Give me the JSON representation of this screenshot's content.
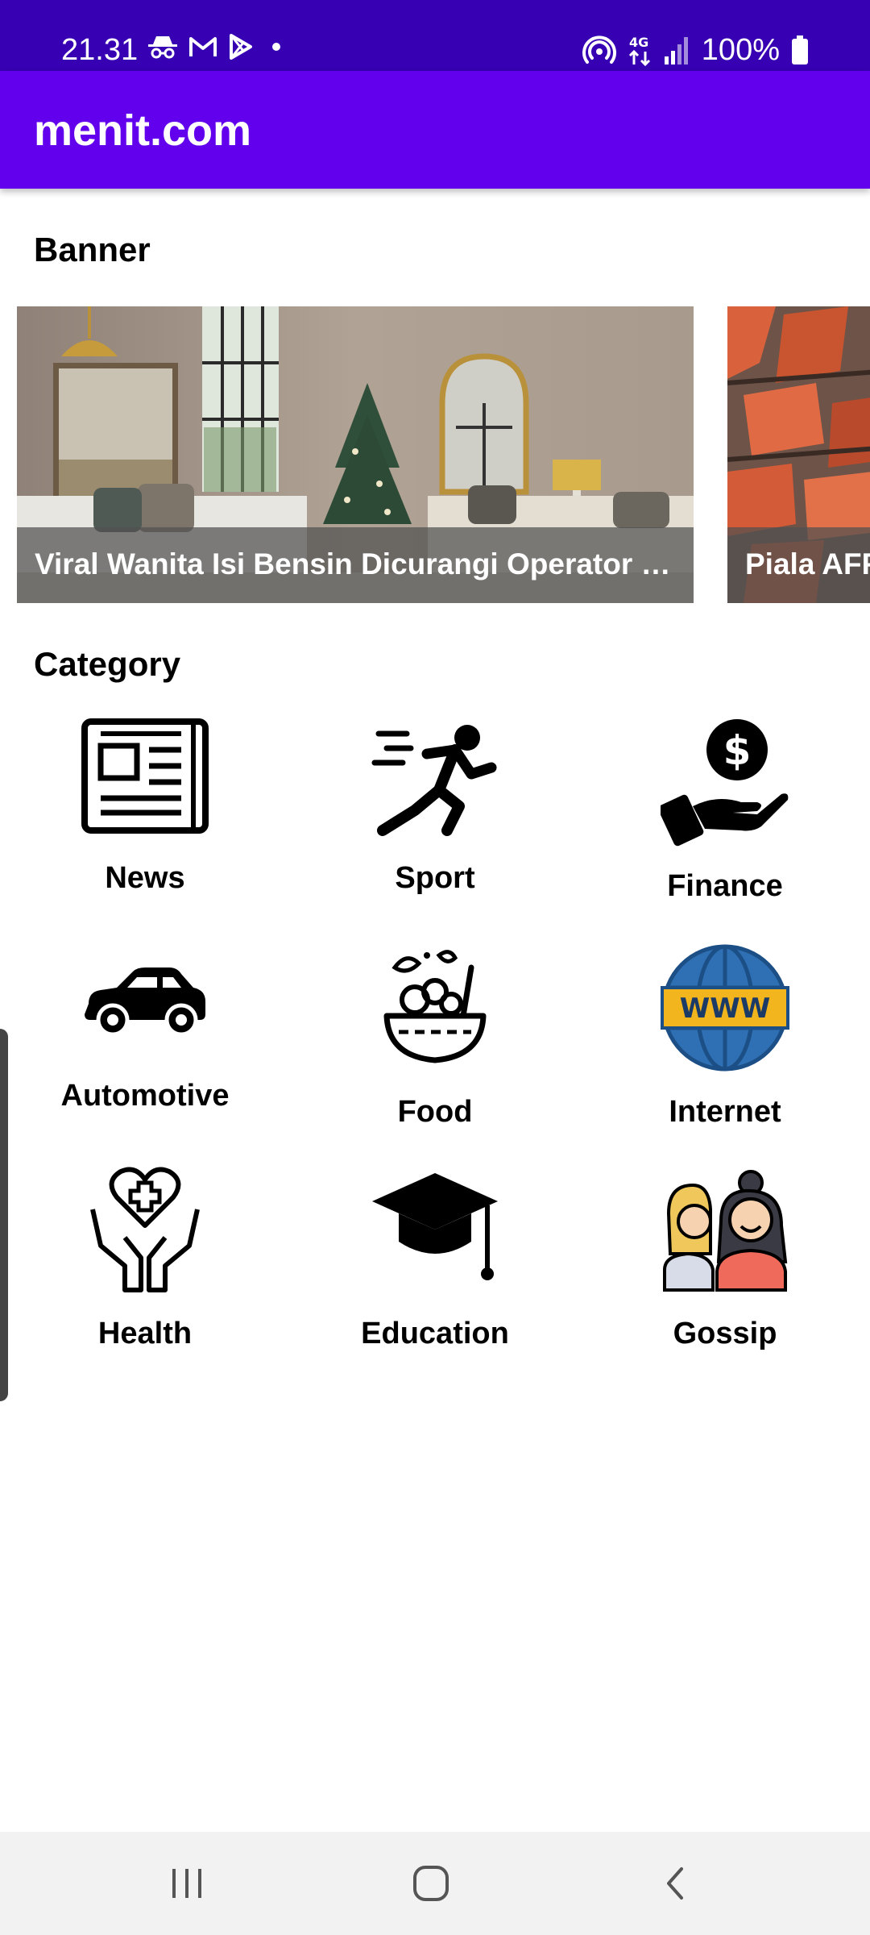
{
  "status_bar": {
    "time": "21.31",
    "battery_text": "100%",
    "network_label": "4G",
    "left_icons": [
      "incognito-icon",
      "gmail-icon",
      "play-store-icon",
      "dot-icon"
    ],
    "right_icons": [
      "hotspot-icon",
      "network-4g-icon",
      "signal-icon",
      "battery-icon"
    ]
  },
  "app_bar": {
    "title": "menit.com"
  },
  "sections": {
    "banner_title": "Banner",
    "category_title": "Category"
  },
  "banners": [
    {
      "caption": "Viral Wanita Isi Bensin Dicurangi Operator SPBU"
    },
    {
      "caption": "Piala AFF"
    }
  ],
  "categories": [
    {
      "label": "News",
      "icon": "newspaper-icon"
    },
    {
      "label": "Sport",
      "icon": "runner-icon"
    },
    {
      "label": "Finance",
      "icon": "money-hand-icon"
    },
    {
      "label": "Automotive",
      "icon": "car-icon"
    },
    {
      "label": "Food",
      "icon": "salad-bowl-icon"
    },
    {
      "label": "Internet",
      "icon": "globe-www-icon"
    },
    {
      "label": "Health",
      "icon": "heart-hands-icon"
    },
    {
      "label": "Education",
      "icon": "graduation-cap-icon"
    },
    {
      "label": "Gossip",
      "icon": "whisper-icon"
    }
  ],
  "colors": {
    "status_bar": "#3700b3",
    "app_bar": "#6200ee",
    "www_yellow": "#f2b51e",
    "globe_blue": "#2f6fb3"
  },
  "nav_bar": {
    "icons": [
      "recent-apps-icon",
      "home-icon",
      "back-icon"
    ]
  }
}
